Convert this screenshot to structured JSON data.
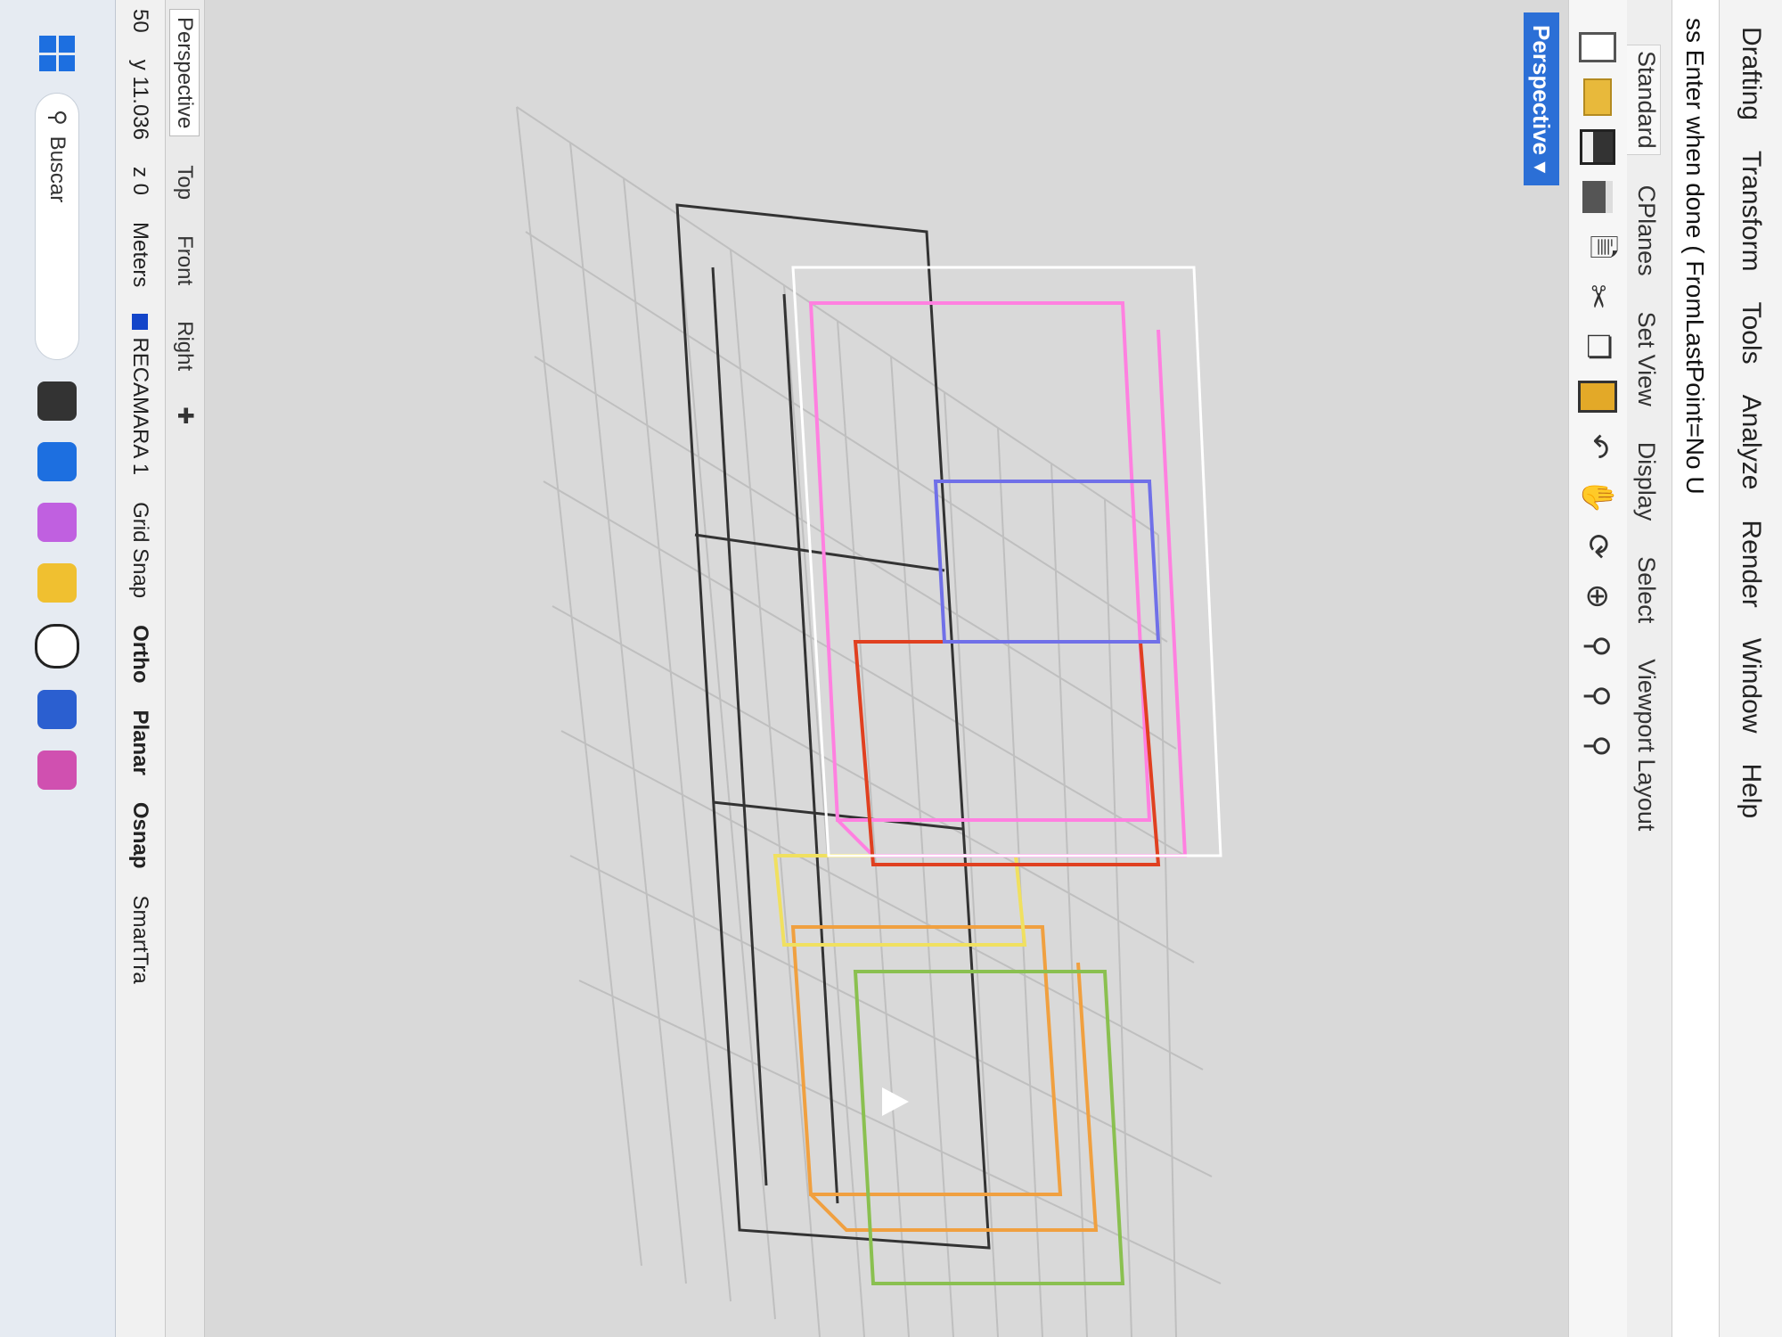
{
  "menu": {
    "items": [
      "Drafting",
      "Transform",
      "Tools",
      "Analyze",
      "Render",
      "Window",
      "Help"
    ]
  },
  "command": {
    "prompt": "ss Enter when done ( FromLastPoint=No U"
  },
  "tabs": {
    "items": [
      "Standard",
      "CPlanes",
      "Set View",
      "Display",
      "Select",
      "Viewport Layout"
    ]
  },
  "viewport": {
    "label": "Perspective"
  },
  "viewport_tabs": {
    "items": [
      "Perspective",
      "Top",
      "Front",
      "Right"
    ]
  },
  "status": {
    "coord_x": "50",
    "coord_y": "y 11.036",
    "coord_z": "z 0",
    "units": "Meters",
    "layer": "RECAMARA 1",
    "grid_snap": "Grid Snap",
    "ortho": "Ortho",
    "planar": "Planar",
    "osnap": "Osnap",
    "smart_track": "SmartTra"
  },
  "taskbar": {
    "search_placeholder": "Buscar"
  },
  "colors": {
    "selection_blue": "#2b6fd6",
    "box_orange": "#f0a040",
    "box_green": "#8ac050",
    "box_yellow": "#f0e060",
    "box_pink": "#ff80e0",
    "box_red": "#e04020",
    "box_purple": "#7070e8"
  }
}
